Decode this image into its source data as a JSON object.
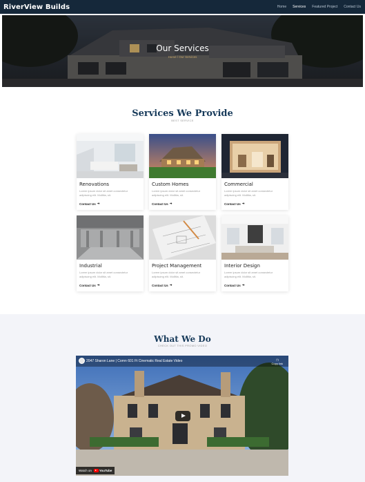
{
  "nav": {
    "brand": "RiverView Builds",
    "items": [
      {
        "label": "Home",
        "active": false
      },
      {
        "label": "Services",
        "active": true
      },
      {
        "label": "Featured Project",
        "active": false
      },
      {
        "label": "Contact Us",
        "active": false
      }
    ]
  },
  "hero": {
    "title": "Our Services",
    "breadcrumb": "Home / Our Services"
  },
  "services": {
    "title": "Services We Provide",
    "subtitle": "BEST SERVICE",
    "link_label": "Contact Us",
    "cards": [
      {
        "title": "Renovations",
        "desc": "Lorem ipsum dolor sit amet consectetur adipiscing elit. Mollitia, sit."
      },
      {
        "title": "Custom Homes",
        "desc": "Lorem ipsum dolor sit amet consectetur adipiscing elit. Mollitia, sit."
      },
      {
        "title": "Commercial",
        "desc": "Lorem ipsum dolor sit amet consectetur adipiscing elit. Mollitia, sit."
      },
      {
        "title": "Industrial",
        "desc": "Lorem ipsum dolor sit amet consectetur adipiscing elit. Mollitia, sit."
      },
      {
        "title": "Project Management",
        "desc": "Lorem ipsum dolor sit amet consectetur adipiscing elit. Mollitia, sit."
      },
      {
        "title": "Interior Design",
        "desc": "Lorem ipsum dolor sit amet consectetur adipiscing elit. Mollitia, sit."
      }
    ]
  },
  "what": {
    "title": "What We Do",
    "subtitle": "CHECK OUT THIS PROMO VIDEO"
  },
  "video": {
    "title": "2047 Sharon Lane | Cornn 601 Ft Cinematic Real Estate Video",
    "copy_label": "Copy link",
    "watch_label": "Watch on",
    "platform": "YouTube"
  },
  "colors": {
    "nav_bg": "#15283a",
    "heading": "#173a5a",
    "accent": "#c9a86a",
    "band_bg": "#f3f4f9"
  }
}
